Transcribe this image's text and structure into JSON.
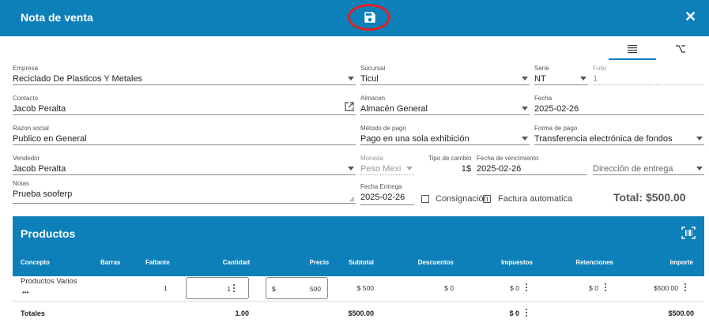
{
  "header": {
    "title": "Nota de venta",
    "save_icon": "save-icon",
    "close_icon": "close-icon"
  },
  "tabs": [
    {
      "icon": "list-icon",
      "active": true
    },
    {
      "icon": "option-icon",
      "active": false
    }
  ],
  "form": {
    "empresa": {
      "label": "Empresa",
      "value": "Reciclado De Plasticos Y Metales"
    },
    "sucursal": {
      "label": "Sucursal",
      "value": "Ticul"
    },
    "serie": {
      "label": "Serie",
      "value": "NT"
    },
    "folio": {
      "label": "Folio",
      "value": "1"
    },
    "contacto": {
      "label": "Contacto",
      "value": "Jacob Peralta"
    },
    "almacen": {
      "label": "Almacen",
      "value": "Almacén General"
    },
    "fecha": {
      "label": "Fecha",
      "value": "2025-02-26"
    },
    "razon_social": {
      "label": "Razon social",
      "value": "Publico en General"
    },
    "metodo_pago": {
      "label": "Método de pago",
      "value": "Pago en una sola exhibición"
    },
    "forma_pago": {
      "label": "Forma de pago",
      "value": "Transferencia electrónica de fondos"
    },
    "vendedor": {
      "label": "Vendedor",
      "value": "Jacob Peralta"
    },
    "moneda": {
      "label": "Moneda",
      "value": "Peso Mexi"
    },
    "tipo_cambio": {
      "label": "Tipo de cambio",
      "value": "1$"
    },
    "fecha_vencimiento": {
      "label": "Fecha de vencimiento",
      "value": "2025-02-26"
    },
    "direccion_entrega": {
      "placeholder": "Dirección de entrega"
    },
    "notas": {
      "label": "Notas",
      "value": "Prueba sooferp"
    },
    "fecha_entrega": {
      "label": "Fecha Entrega",
      "value": "2025-02-26"
    },
    "consignacion": {
      "label": "Consignación",
      "checked": false
    },
    "factura_automatica": {
      "label": "Factura automatica",
      "checked": false
    }
  },
  "total": "Total: $500.00",
  "products": {
    "title": "Productos",
    "columns": [
      "Concepto",
      "Barras",
      "Faltante",
      "Cantidad",
      "Precio",
      "Subtotal",
      "Descuentos",
      "Impuestos",
      "Retenciones",
      "Importe"
    ],
    "rows": [
      {
        "concepto": "Productos Varios",
        "more": "•••",
        "barras": "",
        "faltante": "1",
        "cantidad": "1",
        "precio_symbol": "$",
        "precio": "500",
        "subtotal": "$ 500",
        "descuentos": "$ 0",
        "impuestos": "$ 0",
        "retenciones": "$ 0",
        "importe": "$500.00"
      }
    ],
    "totals": {
      "label": "Totales",
      "cantidad": "1.00",
      "subtotal": "$500.00",
      "impuestos": "$ 0",
      "importe": "$500.00"
    }
  }
}
